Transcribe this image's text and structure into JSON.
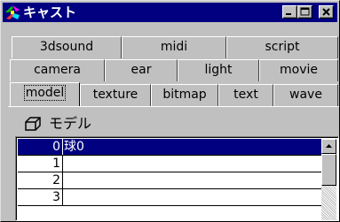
{
  "window": {
    "title": "キャスト"
  },
  "titlebar_buttons": [
    "minimize",
    "maximize",
    "close"
  ],
  "tabs": {
    "row1": [
      "3dsound",
      "midi",
      "script"
    ],
    "row2": [
      "camera",
      "ear",
      "light",
      "movie"
    ],
    "row3": [
      "model",
      "texture",
      "bitmap",
      "text",
      "wave"
    ],
    "active": "model"
  },
  "panel": {
    "heading": "モデル",
    "icon": "cube-icon"
  },
  "list": {
    "rows": [
      {
        "num": "0",
        "name": "球0",
        "selected": true
      },
      {
        "num": "1",
        "name": ""
      },
      {
        "num": "2",
        "name": ""
      },
      {
        "num": "3",
        "name": ""
      }
    ]
  },
  "colors": {
    "titlebar": "#000080",
    "selection": "#000080",
    "face": "#c0c0c0"
  }
}
